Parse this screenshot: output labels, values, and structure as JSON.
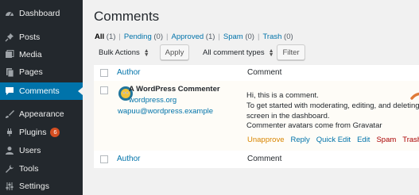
{
  "sidebar": {
    "items": [
      {
        "label": "Dashboard",
        "icon": "dashboard-icon"
      },
      {
        "label": "Posts",
        "icon": "pushpin-icon"
      },
      {
        "label": "Media",
        "icon": "media-icon"
      },
      {
        "label": "Pages",
        "icon": "pages-icon"
      },
      {
        "label": "Comments",
        "icon": "comment-bubble-icon"
      },
      {
        "label": "Appearance",
        "icon": "paintbrush-icon"
      },
      {
        "label": "Plugins",
        "icon": "plugin-icon",
        "badge": "6"
      },
      {
        "label": "Users",
        "icon": "user-icon"
      },
      {
        "label": "Tools",
        "icon": "wrench-icon"
      },
      {
        "label": "Settings",
        "icon": "sliders-icon"
      }
    ]
  },
  "page": {
    "title": "Comments"
  },
  "filters": {
    "all": {
      "label": "All",
      "count": "(1)"
    },
    "pending": {
      "label": "Pending",
      "count": "(0)"
    },
    "approved": {
      "label": "Approved",
      "count": "(1)"
    },
    "spam": {
      "label": "Spam",
      "count": "(0)"
    },
    "trash": {
      "label": "Trash",
      "count": "(0)"
    },
    "separator": "|"
  },
  "toolbar": {
    "bulk_actions": "Bulk Actions",
    "apply": "Apply",
    "comment_types": "All comment types",
    "filter": "Filter"
  },
  "table": {
    "header": {
      "author": "Author",
      "comment": "Comment"
    },
    "footer": {
      "author": "Author",
      "comment": "Comment"
    },
    "rows": [
      {
        "author_name": "A WordPress Commenter",
        "author_url": "wordpress.org",
        "author_email": "wapuu@wordpress.example",
        "comment_lines": [
          "Hi, this is a comment.",
          "To get started with moderating, editing, and deleting c",
          "screen in the dashboard.",
          "Commenter avatars come from Gravatar"
        ],
        "actions": {
          "unapprove": "Unapprove",
          "reply": "Reply",
          "quick_edit": "Quick Edit",
          "edit": "Edit",
          "spam": "Spam",
          "trash": "Trash"
        }
      }
    ]
  },
  "colors": {
    "sidebar_bg": "#23282d",
    "active_bg": "#0073aa",
    "link": "#0073aa",
    "unapprove": "#d98500",
    "danger": "#aa0000",
    "annotation_arrow": "#e07b39"
  }
}
